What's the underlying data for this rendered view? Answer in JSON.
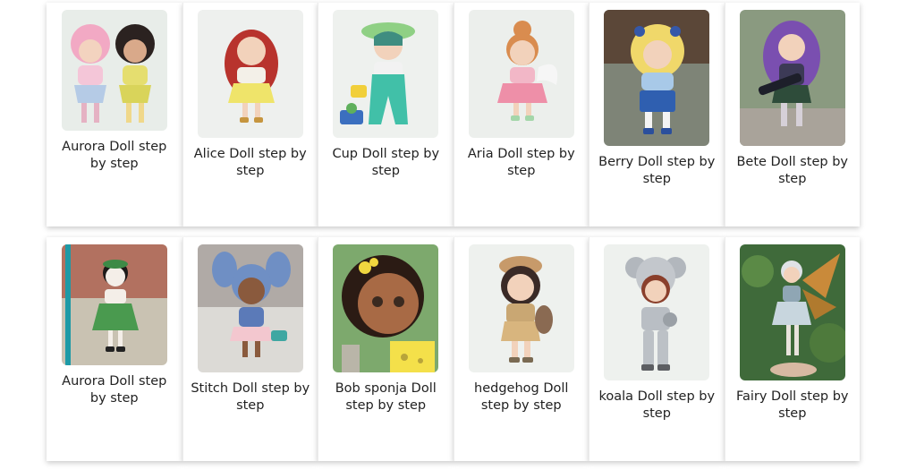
{
  "rows": [
    {
      "cards": [
        {
          "title": "Aurora Doll step by step",
          "image": "aurora-doll-photo"
        },
        {
          "title": "Alice Doll step by step",
          "image": "alice-doll-photo"
        },
        {
          "title": "Cup Doll step by step",
          "image": "cup-doll-photo"
        },
        {
          "title": "Aria Doll step by step",
          "image": "aria-doll-photo"
        },
        {
          "title": "Berry  Doll step by step",
          "image": "berry-doll-photo"
        },
        {
          "title": "Bete Doll step by step",
          "image": "bete-doll-photo"
        }
      ]
    },
    {
      "cards": [
        {
          "title": "Aurora Doll step by step",
          "image": "aurora-green-doll-photo"
        },
        {
          "title": "Stitch Doll step by step",
          "image": "stitch-doll-photo"
        },
        {
          "title": "Bob sponja  Doll step by step",
          "image": "bob-sponja-doll-photo"
        },
        {
          "title": "hedgehog Doll step by step",
          "image": "hedgehog-doll-photo"
        },
        {
          "title": "koala Doll step by step",
          "image": "koala-doll-photo"
        },
        {
          "title": "Fairy Doll step by step",
          "image": "fairy-doll-photo"
        }
      ]
    }
  ]
}
